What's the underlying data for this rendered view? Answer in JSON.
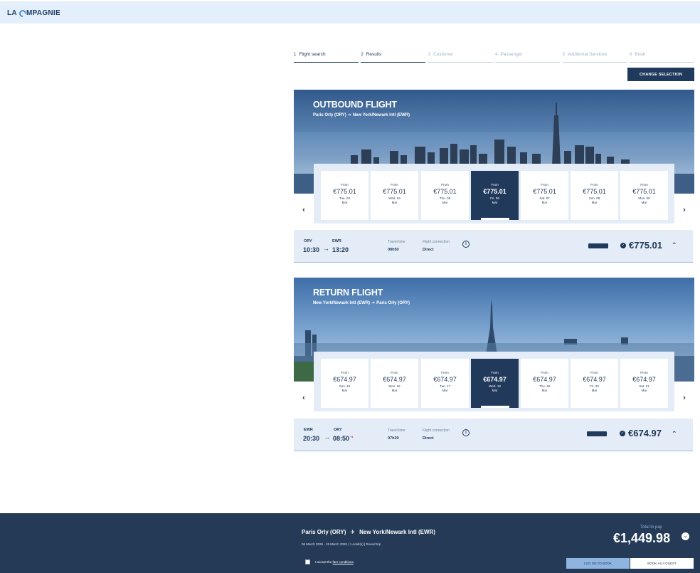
{
  "brand": {
    "logo_left": "LA ",
    "logo_right": "MPAGNIE"
  },
  "steps": [
    {
      "num": "1",
      "label": "Flight search"
    },
    {
      "num": "2",
      "label": "Results"
    },
    {
      "num": "3",
      "label": "Customer"
    },
    {
      "num": "4",
      "label": "Passenger"
    },
    {
      "num": "5",
      "label": "Additional Services"
    },
    {
      "num": "6",
      "label": "Book"
    }
  ],
  "change_selection_label": "CHANGE SELECTION",
  "outbound": {
    "title": "OUTBOUND FLIGHT",
    "origin": "Paris Orly (ORY)",
    "destination": "New York/Newark Intl (EWR)",
    "dates": [
      {
        "from": "From",
        "price": "€775.01",
        "day": "Tue. 03",
        "month": "Mar"
      },
      {
        "from": "From",
        "price": "€775.01",
        "day": "Wed. 04",
        "month": "Mar"
      },
      {
        "from": "From",
        "price": "€775.01",
        "day": "Thu. 05",
        "month": "Mar"
      },
      {
        "from": "From",
        "price": "€775.01",
        "day": "Fri. 06",
        "month": "Mar"
      },
      {
        "from": "From",
        "price": "€775.01",
        "day": "Sat. 07",
        "month": "Mar"
      },
      {
        "from": "From",
        "price": "€775.01",
        "day": "Sun. 08",
        "month": "Mar"
      },
      {
        "from": "From",
        "price": "€775.01",
        "day": "Mon. 09",
        "month": "Mar"
      }
    ],
    "flight": {
      "dep_code": "ORY",
      "arr_code": "EWR",
      "dep_time": "10:30",
      "arr_time": "13:20",
      "travel_time_label": "Travel time",
      "travel_time": "08h50",
      "connection_label": "Flight connection",
      "connection": "Direct",
      "price": "€775.01"
    }
  },
  "return": {
    "title": "RETURN FLIGHT",
    "origin": "New York/Newark Intl (EWR)",
    "destination": "Paris Orly (ORY)",
    "dates": [
      {
        "from": "From",
        "price": "€674.97",
        "day": "Sun. 15",
        "month": "Mar"
      },
      {
        "from": "From",
        "price": "€674.97",
        "day": "Mon. 16",
        "month": "Mar"
      },
      {
        "from": "From",
        "price": "€674.97",
        "day": "Tue. 17",
        "month": "Mar"
      },
      {
        "from": "From",
        "price": "€674.97",
        "day": "Wed. 18",
        "month": "Mar"
      },
      {
        "from": "From",
        "price": "€674.97",
        "day": "Thu. 19",
        "month": "Mar"
      },
      {
        "from": "From",
        "price": "€674.97",
        "day": "Fri. 20",
        "month": "Mar"
      },
      {
        "from": "From",
        "price": "€674.97",
        "day": "Sat. 21",
        "month": "Mar"
      }
    ],
    "flight": {
      "dep_code": "EWR",
      "arr_code": "ORY",
      "dep_time": "20:30",
      "arr_time": "08:50",
      "day_offset": "+1",
      "travel_time_label": "Travel time",
      "travel_time": "07h20",
      "connection_label": "Flight connection",
      "connection": "Direct",
      "price": "€674.97"
    }
  },
  "footer": {
    "origin": "Paris Orly (ORY)",
    "destination": "New York/Newark Intl (EWR)",
    "summary": "06 March 2026 - 18 March 2026  |  1 Adult(s)  |  Round trip",
    "total_label": "Total to pay",
    "total": "€1,449.98",
    "accept_prefix": "I accept the ",
    "accept_link": "fare conditions",
    "accept_suffix": ".",
    "login_label": "LOG ON TO BOOK",
    "guest_label": "BOOK AS A GUEST"
  },
  "colors": {
    "navy": "#1d3557",
    "dark_button": "#1f3a5c",
    "panel": "#e4edf7",
    "topbar": "#e3effb",
    "accent_light": "#8fb4e0"
  }
}
